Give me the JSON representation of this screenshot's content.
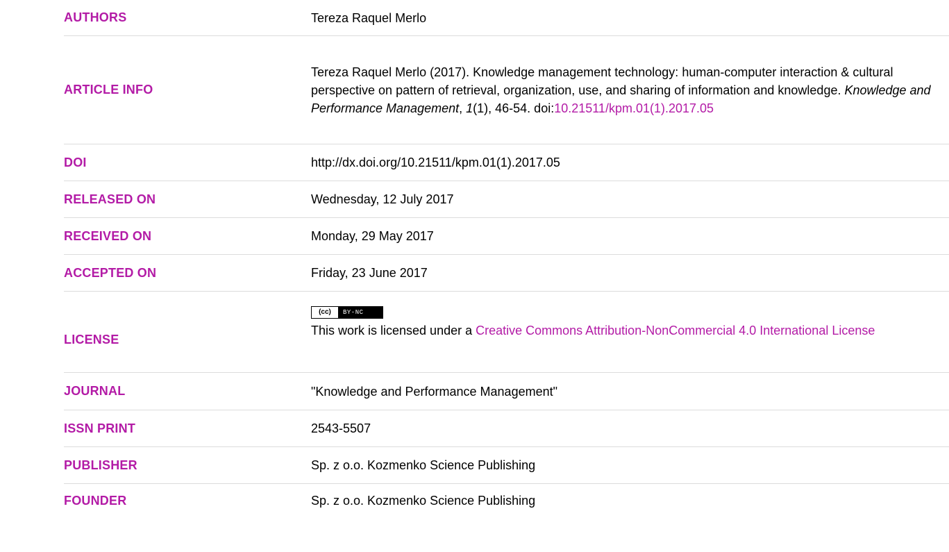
{
  "rows": {
    "authors": {
      "label": "AUTHORS",
      "value": "Tereza Raquel Merlo"
    },
    "article_info": {
      "label": "ARTICLE INFO",
      "text_before": "Tereza Raquel Merlo (2017). Knowledge management technology: human-computer interaction & cultural perspective on pattern of retrieval, organization, use, and sharing of information and knowledge. ",
      "journal_italic": "Knowledge and Performance Management",
      "comma": ", ",
      "volume_italic": "1",
      "issue_pages": "(1), 46-54. doi:",
      "doi_link": "10.21511/kpm.01(1).2017.05"
    },
    "doi": {
      "label": "DOI",
      "value": "http://dx.doi.org/10.21511/kpm.01(1).2017.05"
    },
    "released_on": {
      "label": "RELEASED ON",
      "value": "Wednesday, 12 July 2017"
    },
    "received_on": {
      "label": "RECEIVED ON",
      "value": "Monday, 29 May 2017"
    },
    "accepted_on": {
      "label": "ACCEPTED ON",
      "value": "Friday, 23 June 2017"
    },
    "license": {
      "label": "LICENSE",
      "badge_cc": "(cc)",
      "badge_terms": "BY-NC",
      "text_before": "This work is licensed under a ",
      "link_text": "Creative Commons Attribution-NonCommercial 4.0 International License"
    },
    "journal": {
      "label": "JOURNAL",
      "value": "\"Knowledge and Performance Management\""
    },
    "issn_print": {
      "label": "ISSN PRINT",
      "value": "2543-5507"
    },
    "publisher": {
      "label": "PUBLISHER",
      "value": "Sp. z o.o. Kozmenko Science Publishing"
    },
    "founder": {
      "label": "FOUNDER",
      "value": "Sp. z o.o. Kozmenko Science Publishing"
    }
  },
  "colors": {
    "accent": "#b31ba6",
    "divider": "#dcdcdc"
  }
}
